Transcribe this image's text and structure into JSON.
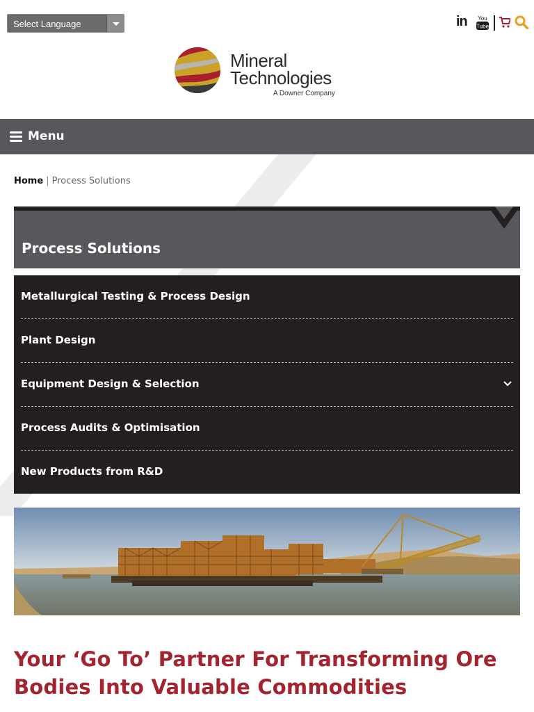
{
  "header": {
    "language_select": "Select Language",
    "social": [
      "linkedin-icon",
      "youtube-icon",
      "cart-icon",
      "search-icon"
    ],
    "youtube_text": [
      "You",
      "Tube"
    ]
  },
  "logo": {
    "line1": "Mineral",
    "line2": "Technologies",
    "tagline": "A Downer Company"
  },
  "menu": {
    "label": "Menu"
  },
  "breadcrumb": {
    "home": "Home",
    "separator": "|",
    "current": "Process Solutions"
  },
  "section": {
    "title": "Process Solutions",
    "items": [
      {
        "label": "Metallurgical Testing & Process Design"
      },
      {
        "label": "Plant Design"
      },
      {
        "label": "Equipment Design & Selection",
        "has_submenu": true
      },
      {
        "label": "Process Audits & Optimisation"
      },
      {
        "label": "New Products from R&D"
      }
    ]
  },
  "headline": "Your ‘Go To’ Partner For Transforming Ore Bodies Into Valuable Commodities",
  "colors": {
    "menu_bar": "#58585c",
    "nav_bg": "#231f20",
    "headline": "#a3242f",
    "search_icon": "#e8a020",
    "cart_icon": "#b0222d"
  }
}
